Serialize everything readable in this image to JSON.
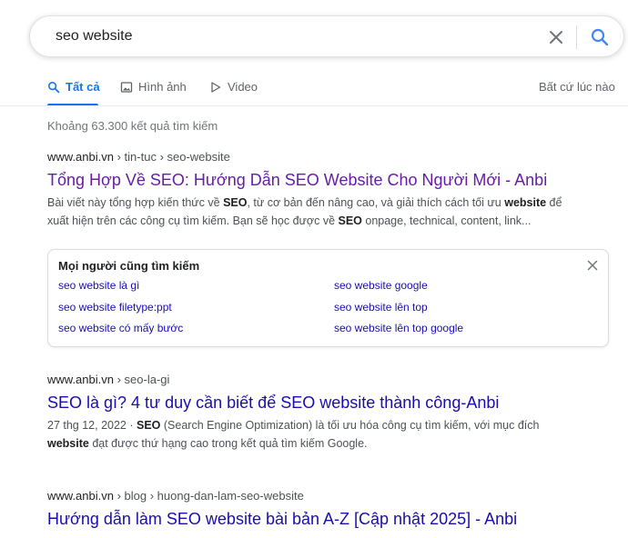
{
  "search": {
    "query": "seo website"
  },
  "tabs": [
    {
      "label": "Tất cả"
    },
    {
      "label": "Hình ảnh"
    },
    {
      "label": "Video"
    }
  ],
  "time_filter": "Bất cứ lúc nào",
  "result_count": "Khoảng 63.300 kết quả tìm kiếm",
  "results": [
    {
      "domain": "www.anbi.vn",
      "path": "› tin-tuc › seo-website",
      "title": "Tổng Hợp Về SEO: Hướng Dẫn SEO Website Cho Người Mới - Anbi",
      "snippet_line1_a": "Bài viết này tổng hợp kiến thức về ",
      "snippet_line1_b": "SEO",
      "snippet_line1_c": ", từ cơ bản đến nâng cao, và giải thích cách tối ưu ",
      "snippet_line1_d": "website",
      "snippet_line1_e": " để",
      "snippet_line2_a": "xuất hiện trên các công cụ tìm kiếm. Bạn sẽ học được về ",
      "snippet_line2_b": "SEO",
      "snippet_line2_c": " onpage, technical, content, link..."
    },
    {
      "domain": "www.anbi.vn",
      "path": "› seo-la-gi",
      "title": "SEO là gì? 4 tư duy cần biết để SEO website thành công-Anbi",
      "snippet_line1_a": "27 thg 12, 2022 · ",
      "snippet_line1_b": "SEO",
      "snippet_line1_c": " (Search Engine Optimization) là tối ưu hóa công cụ tìm kiếm, với mục đích",
      "snippet_line2_a": "website",
      "snippet_line2_b": " đạt được thứ hạng cao trong kết quả tìm kiếm Google."
    },
    {
      "domain": "www.anbi.vn",
      "path": "› blog › huong-dan-lam-seo-website",
      "title": "Hướng dẫn làm SEO website bài bản A-Z [Cập nhật 2025] - Anbi"
    }
  ],
  "also_searched": {
    "title": "Mọi người cũng tìm kiếm",
    "links": [
      "seo website là gì",
      "seo website google",
      "seo website filetype:ppt",
      "seo website lên top",
      "seo website có mấy bước",
      "seo website lên top google"
    ]
  },
  "colors": {
    "link": "#1a0dab",
    "visited": "#681da8",
    "accent": "#1a73e8",
    "snippet": "#4d5156"
  }
}
